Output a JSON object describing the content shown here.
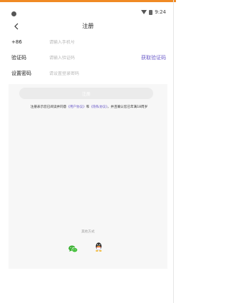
{
  "status_bar": {
    "time": "9:24"
  },
  "nav": {
    "title": "注册"
  },
  "form": {
    "phone": {
      "prefix": "+86",
      "placeholder": "请输入手机号"
    },
    "code": {
      "label": "验证码",
      "placeholder": "请输入验证码",
      "action": "获取验证码"
    },
    "password": {
      "label": "设置密码",
      "placeholder": "请设置登录密码"
    }
  },
  "submit": {
    "label": "注册"
  },
  "agreement": {
    "prefix": "注册表示您已阅读并同意",
    "user_agreement": "《用户协议》",
    "and": "和",
    "privacy_policy": "《隐私协议》",
    "suffix": "，并且确认您已年满18周岁"
  },
  "other_login": {
    "label": "其他方式"
  },
  "colors": {
    "accent": "#6b5bc8",
    "top_bar": "#f08a24",
    "wechat": "#3cb034",
    "button_disabled": "#ebebeb"
  },
  "icons": {
    "back": "back-arrow-icon",
    "wechat": "wechat-icon",
    "qq": "qq-icon"
  }
}
